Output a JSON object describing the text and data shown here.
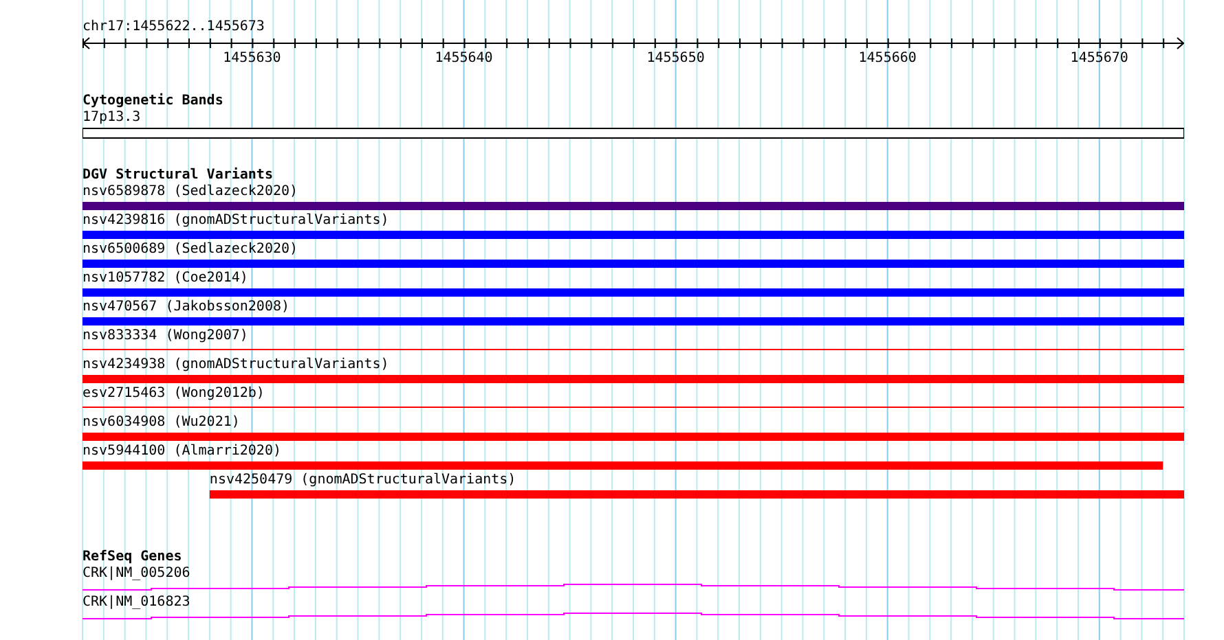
{
  "position": "chr17:1455622..1455673",
  "ruler": {
    "labels": [
      "1455630",
      "1455640",
      "1455650",
      "1455660",
      "1455670"
    ]
  },
  "cytogenetic_bands": {
    "title": "Cytogenetic Bands",
    "band": "17p13.3"
  },
  "dgv_structural_variants": {
    "title": "DGV Structural Variants",
    "items": [
      {
        "label": "nsv6589878 (Sedlazeck2020)",
        "kind": "thick",
        "color": "#4b0082",
        "extends_left": true,
        "extends_right": true
      },
      {
        "label": "nsv4239816 (gnomADStructuralVariants)",
        "kind": "thick",
        "color": "#0000ff",
        "extends_left": true,
        "extends_right": true
      },
      {
        "label": "nsv6500689 (Sedlazeck2020)",
        "kind": "thick",
        "color": "#0000ff",
        "extends_left": true,
        "extends_right": true
      },
      {
        "label": "nsv1057782 (Coe2014)",
        "kind": "thick",
        "color": "#0000ff",
        "extends_left": true,
        "extends_right": true
      },
      {
        "label": "nsv470567 (Jakobsson2008)",
        "kind": "thick",
        "color": "#0000ff",
        "extends_left": true,
        "extends_right": true
      },
      {
        "label": "nsv833334 (Wong2007)",
        "kind": "thin",
        "color": "#ff0000",
        "extends_left": true,
        "extends_right": true
      },
      {
        "label": "nsv4234938 (gnomADStructuralVariants)",
        "kind": "thick",
        "color": "#ff0000",
        "extends_left": true,
        "extends_right": true
      },
      {
        "label": "esv2715463 (Wong2012b)",
        "kind": "thin",
        "color": "#ff0000",
        "extends_left": true,
        "extends_right": true
      },
      {
        "label": "nsv6034908 (Wu2021)",
        "kind": "thick",
        "color": "#ff0000",
        "extends_left": true,
        "extends_right": true
      },
      {
        "label": "nsv5944100 (Almarri2020)",
        "kind": "thick",
        "color": "#ff0000",
        "extends_left": true,
        "extends_right": false
      },
      {
        "label": "nsv4250479 (gnomADStructuralVariants)",
        "kind": "thick",
        "color": "#ff0000",
        "extends_left": false,
        "extends_right": true
      }
    ]
  },
  "refseq_genes": {
    "title": "RefSeq Genes",
    "items": [
      {
        "label": "CRK|NM_005206"
      },
      {
        "label": "CRK|NM_016823"
      }
    ]
  }
}
